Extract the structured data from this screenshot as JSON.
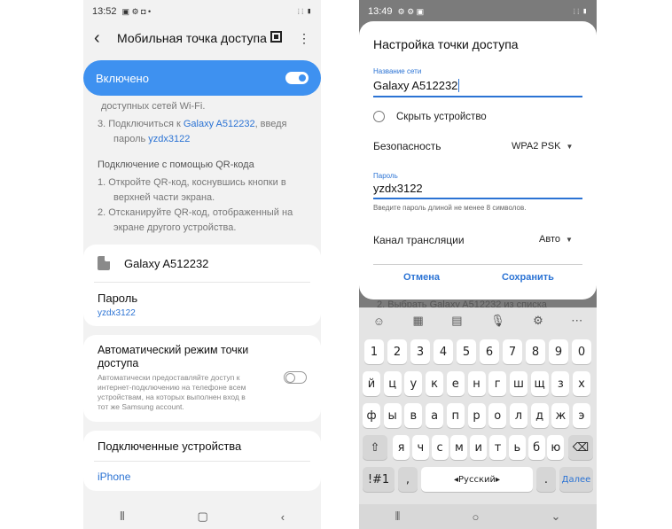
{
  "left": {
    "status": {
      "time": "13:52",
      "icons": "▣ ⚙ ◘ •",
      "right_icons": "⦙ ⦙ ▮"
    },
    "header": {
      "title": "Мобильная точка доступа"
    },
    "enabled": {
      "label": "Включено"
    },
    "instructions": {
      "cut_line": "доступных сетей Wi-Fi.",
      "step3_prefix": "3. Подключиться к ",
      "step3_network": "Galaxy A512232",
      "step3_mid": ", введя",
      "step3_pass_prefix": "пароль ",
      "step3_password": "yzdx3122",
      "qr_heading": "Подключение с помощью QR-кода",
      "qr_step1_line1": "1. Откройте QR-код, коснувшись кнопки в",
      "qr_step1_line2": "верхней части экрана.",
      "qr_step2_line1": "2. Отсканируйте QR-код, отображенный на",
      "qr_step2_line2": "экране другого устройства."
    },
    "network_card": {
      "name": "Galaxy A512232",
      "password_label": "Пароль",
      "password_value": "yzdx3122"
    },
    "auto_card": {
      "title_line1": "Автоматический режим точки",
      "title_line2": "доступа",
      "desc_line1": "Автоматически предоставляйте доступ к",
      "desc_line2": "интернет-подключению на телефоне всем",
      "desc_line3": "устройствам, на которых выполнен вход в",
      "desc_line4": "тот же Samsung account."
    },
    "devices_card": {
      "title": "Подключенные устройства",
      "device": "iPhone"
    }
  },
  "right": {
    "status": {
      "time": "13:49",
      "icons": "⚙ ⚙ ▣",
      "right_icons": "⦙ ⦙ ▮"
    },
    "dialog": {
      "title": "Настройка точки доступа",
      "network_label": "Название сети",
      "network_value": "Galaxy A512232",
      "hide_device": "Скрыть устройство",
      "security_label": "Безопасность",
      "security_value": "WPA2 PSK",
      "password_label": "Пароль",
      "password_value": "yzdx3122",
      "password_hint": "Введите пароль длиной не менее 8 символов.",
      "channel_label": "Канал трансляции",
      "channel_value": "Авто",
      "cancel": "Отмена",
      "save": "Сохранить"
    },
    "behind_text": "2. Выбрать Galaxy A512232 из списка",
    "keyboard": {
      "row_digits": [
        "1",
        "2",
        "3",
        "4",
        "5",
        "6",
        "7",
        "8",
        "9",
        "0"
      ],
      "row1": [
        "й",
        "ц",
        "у",
        "к",
        "е",
        "н",
        "г",
        "ш",
        "щ",
        "з",
        "х"
      ],
      "row2": [
        "ф",
        "ы",
        "в",
        "а",
        "п",
        "р",
        "о",
        "л",
        "д",
        "ж",
        "э"
      ],
      "row3": [
        "я",
        "ч",
        "с",
        "м",
        "и",
        "т",
        "ь",
        "б",
        "ю"
      ],
      "symbols_key": "!#1",
      "comma": ",",
      "space": "Русский",
      "period": ".",
      "next": "Далее"
    }
  }
}
